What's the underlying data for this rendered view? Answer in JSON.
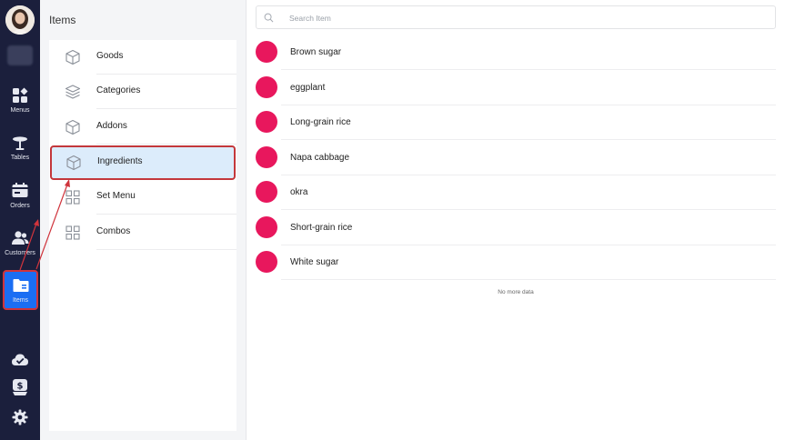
{
  "sidebar": {
    "items": [
      {
        "label": "Menus",
        "icon": "menus-icon"
      },
      {
        "label": "Tables",
        "icon": "tables-icon"
      },
      {
        "label": "Orders",
        "icon": "orders-icon"
      },
      {
        "label": "Customers",
        "icon": "customers-icon"
      },
      {
        "label": "Items",
        "icon": "items-icon",
        "active": true
      }
    ],
    "footer_icons": [
      "cloud-check-icon",
      "cash-icon",
      "gear-icon"
    ]
  },
  "categories": {
    "title": "Items",
    "items": [
      {
        "label": "Goods",
        "icon": "cube-icon"
      },
      {
        "label": "Categories",
        "icon": "layers-icon"
      },
      {
        "label": "Addons",
        "icon": "cube-icon"
      },
      {
        "label": "Ingredients",
        "icon": "cube-icon",
        "active": true
      },
      {
        "label": "Set Menu",
        "icon": "grid-icon"
      },
      {
        "label": "Combos",
        "icon": "grid-icon"
      }
    ]
  },
  "main": {
    "search_placeholder": "Search Item",
    "items": [
      "Brown sugar",
      "eggplant",
      "Long-grain rice",
      "Napa cabbage",
      "okra",
      "Short-grain rice",
      "White sugar"
    ],
    "footer": "No more data"
  },
  "colors": {
    "rail_bg": "#1b1f3c",
    "accent": "#1b6ef3",
    "item_dot": "#e8175d",
    "highlight_border": "#c3373b",
    "active_row_bg": "#dcecfb"
  }
}
